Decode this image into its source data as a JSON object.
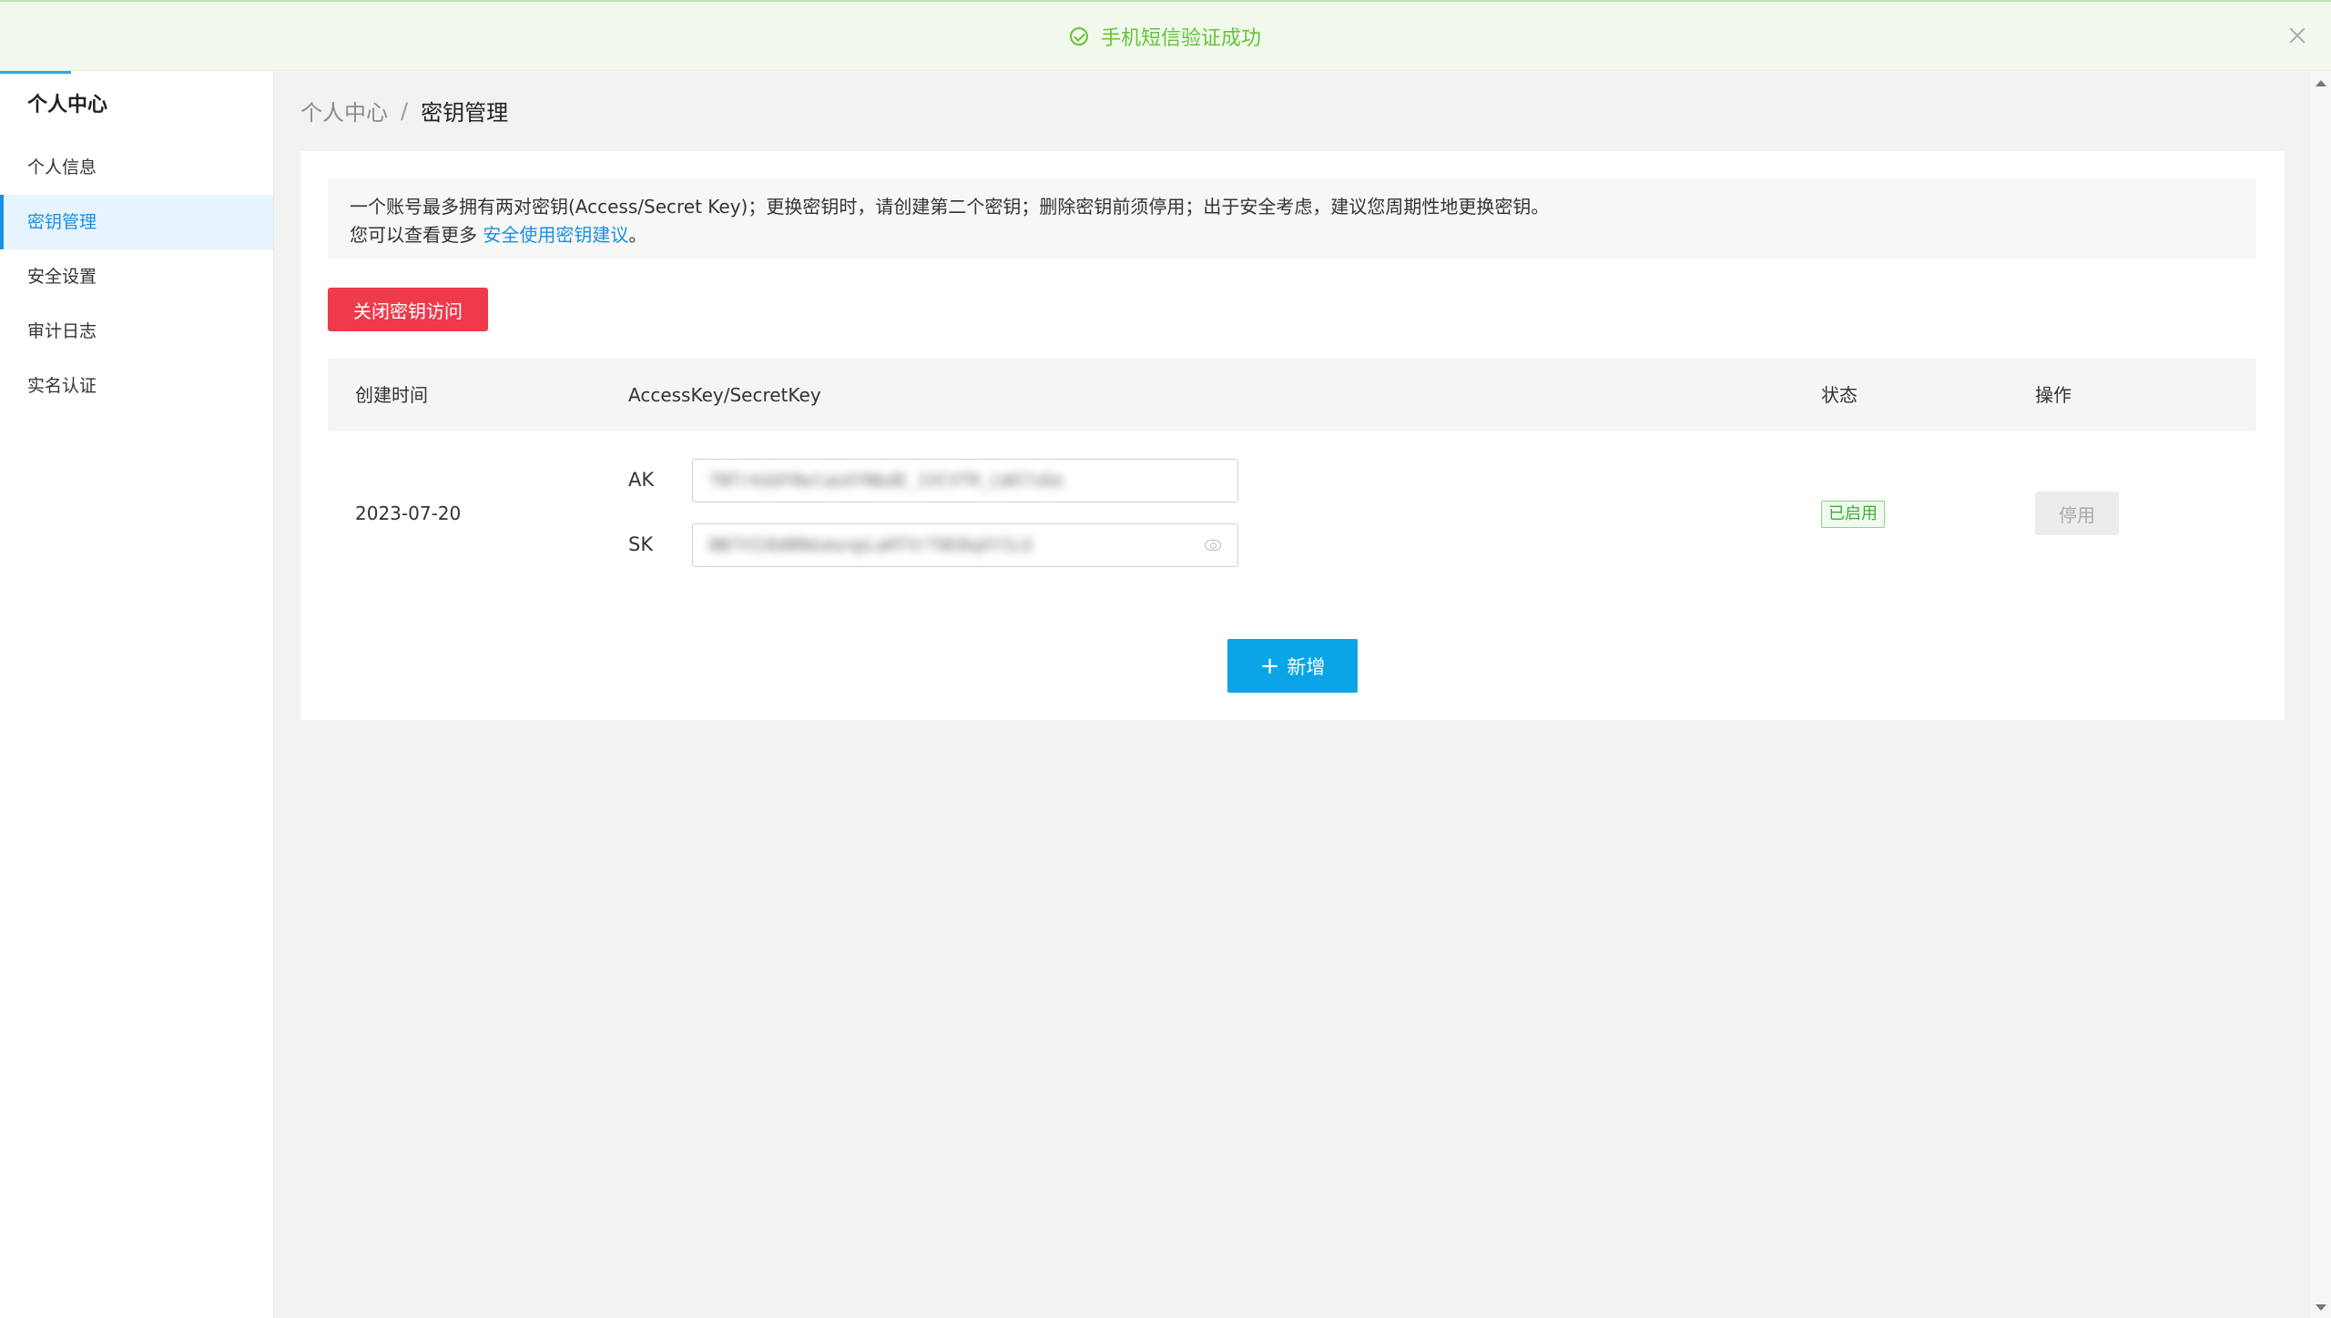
{
  "toast": {
    "message": "手机短信验证成功",
    "color": "#67c23a"
  },
  "sidebar": {
    "title": "个人中心",
    "items": [
      {
        "label": "个人信息",
        "active": false
      },
      {
        "label": "密钥管理",
        "active": true
      },
      {
        "label": "安全设置",
        "active": false
      },
      {
        "label": "审计日志",
        "active": false
      },
      {
        "label": "实名认证",
        "active": false
      }
    ]
  },
  "breadcrumb": {
    "parent": "个人中心",
    "separator": "/",
    "current": "密钥管理"
  },
  "notice": {
    "line1": "一个账号最多拥有两对密钥(Access/Secret Key)；更换密钥时，请创建第二个密钥；删除密钥前须停用；出于安全考虑，建议您周期性地更换密钥。",
    "line2_prefix": "您可以查看更多 ",
    "link": "安全使用密钥建议",
    "line2_suffix": "。"
  },
  "close_access_button": "关闭密钥访问",
  "table": {
    "headers": {
      "created": "创建时间",
      "keys": "AccessKey/SecretKey",
      "status": "状态",
      "actions": "操作"
    },
    "rows": [
      {
        "created": "2023-07-20",
        "ak_label": "AK",
        "sk_label": "SK",
        "status": "已启用",
        "action": "停用"
      }
    ]
  },
  "add_button": {
    "icon": "+",
    "label": "新增"
  },
  "colors": {
    "primary": "#0aa5e6",
    "danger": "#ee3a4a",
    "link": "#1a8fe3",
    "success": "#3aae36"
  }
}
